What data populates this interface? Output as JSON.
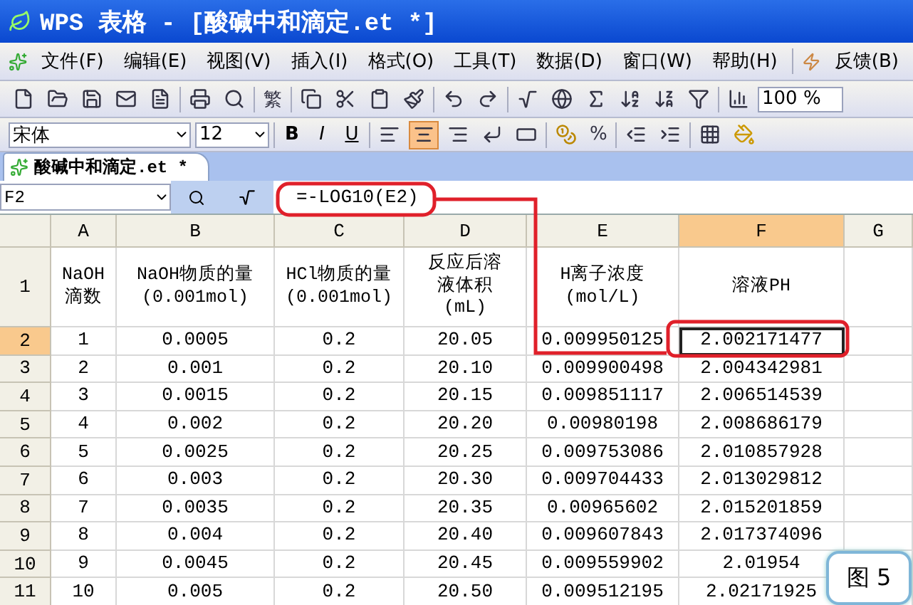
{
  "window": {
    "title": "WPS 表格 - [酸碱中和滴定.et *]"
  },
  "menu": [
    {
      "label": "文件(F)"
    },
    {
      "label": "编辑(E)"
    },
    {
      "label": "视图(V)"
    },
    {
      "label": "插入(I)"
    },
    {
      "label": "格式(O)"
    },
    {
      "label": "工具(T)"
    },
    {
      "label": "数据(D)"
    },
    {
      "label": "窗口(W)"
    },
    {
      "label": "帮助(H)"
    },
    {
      "label": "反馈(B)"
    }
  ],
  "toolbar": {
    "convert": "繁",
    "zoom": "100 %"
  },
  "format_bar": {
    "font": "宋体",
    "size": "12",
    "styles": [
      {
        "label": "B"
      },
      {
        "label": "I"
      },
      {
        "label": "U"
      }
    ],
    "align": [
      {
        "selected": false
      },
      {
        "selected": true
      },
      {
        "selected": false
      }
    ],
    "percent": "%"
  },
  "document_tab": {
    "label": "酸碱中和滴定.et *"
  },
  "formula_bar": {
    "cell_ref": "F2",
    "formula": "=-LOG10(E2)"
  },
  "columns": [
    {
      "label": "A",
      "selected": false
    },
    {
      "label": "B",
      "selected": false
    },
    {
      "label": "C",
      "selected": false
    },
    {
      "label": "D",
      "selected": false
    },
    {
      "label": "E",
      "selected": false
    },
    {
      "label": "F",
      "selected": true
    },
    {
      "label": "G",
      "selected": false
    }
  ],
  "rows": [
    {
      "number": "1",
      "selected": false,
      "cells": [
        "NaOH\n滴数",
        "NaOH物质的量\n(0.001mol)",
        "HCl物质的量\n(0.001mol)",
        "反应后溶液体积(mL)",
        "H离子浓度\n(mol/L)",
        "溶液PH",
        ""
      ]
    },
    {
      "number": "2",
      "selected": true,
      "cells": [
        "1",
        "0.0005",
        "0.2",
        "20.05",
        "0.009950125",
        "2.002171477",
        ""
      ]
    },
    {
      "number": "3",
      "selected": false,
      "cells": [
        "2",
        "0.001",
        "0.2",
        "20.10",
        "0.009900498",
        "2.004342981",
        ""
      ]
    },
    {
      "number": "4",
      "selected": false,
      "cells": [
        "3",
        "0.0015",
        "0.2",
        "20.15",
        "0.009851117",
        "2.006514539",
        ""
      ]
    },
    {
      "number": "5",
      "selected": false,
      "cells": [
        "4",
        "0.002",
        "0.2",
        "20.20",
        "0.00980198",
        "2.008686179",
        ""
      ]
    },
    {
      "number": "6",
      "selected": false,
      "cells": [
        "5",
        "0.0025",
        "0.2",
        "20.25",
        "0.009753086",
        "2.010857928",
        ""
      ]
    },
    {
      "number": "7",
      "selected": false,
      "cells": [
        "6",
        "0.003",
        "0.2",
        "20.30",
        "0.009704433",
        "2.013029812",
        ""
      ]
    },
    {
      "number": "8",
      "selected": false,
      "cells": [
        "7",
        "0.0035",
        "0.2",
        "20.35",
        "0.00965602",
        "2.015201859",
        ""
      ]
    },
    {
      "number": "9",
      "selected": false,
      "cells": [
        "8",
        "0.004",
        "0.2",
        "20.40",
        "0.009607843",
        "2.017374096",
        ""
      ]
    },
    {
      "number": "10",
      "selected": false,
      "cells": [
        "9",
        "0.0045",
        "0.2",
        "20.45",
        "0.009559902",
        "2.01954",
        ""
      ]
    },
    {
      "number": "11",
      "selected": false,
      "cells": [
        "10",
        "0.005",
        "0.2",
        "20.50",
        "0.009512195",
        "2.02171925",
        ""
      ]
    }
  ],
  "callout": "图 5"
}
